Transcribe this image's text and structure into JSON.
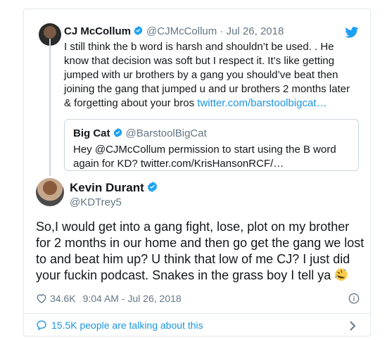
{
  "quoted_tweet": {
    "author_name": "CJ McCollum",
    "author_handle": "@CJMcCollum",
    "date": " · Jul 26, 2018",
    "text": "I still think the b word is harsh and shouldn’t be used. . He know that decision was soft but I respect it. It’s like getting jumped with ur brothers by a gang you should’ve beat then joining the gang that jumped u and ur brothers 2 months later & forgetting about your bros ",
    "link": "twitter.com/barstoolbigcat…",
    "nested_quote": {
      "author_name": "Big Cat",
      "author_handle": "@BarstoolBigCat",
      "text": "Hey @CJMcCollum permission to start using the B word again for KD? twitter.com/KrisHansonRCF/…"
    }
  },
  "tweet": {
    "author_name": "Kevin Durant",
    "author_handle": "@KDTrey5",
    "text": "So,I would get into a gang fight, lose, plot on my brother for 2 months in our home and then go get the gang we lost to and beat him up? U think that low of me CJ? I just did your fuckin podcast. Snakes in the grass boy I tell ya ",
    "emoji": "rolling-on-floor-laughing",
    "likes": "34.6K",
    "timestamp": "9:04 AM - Jul 26, 2018",
    "talking": "15.5K people are talking about this"
  },
  "colors": {
    "link": "#1b95e0",
    "verified": "#1da1f2",
    "muted": "#657786"
  }
}
